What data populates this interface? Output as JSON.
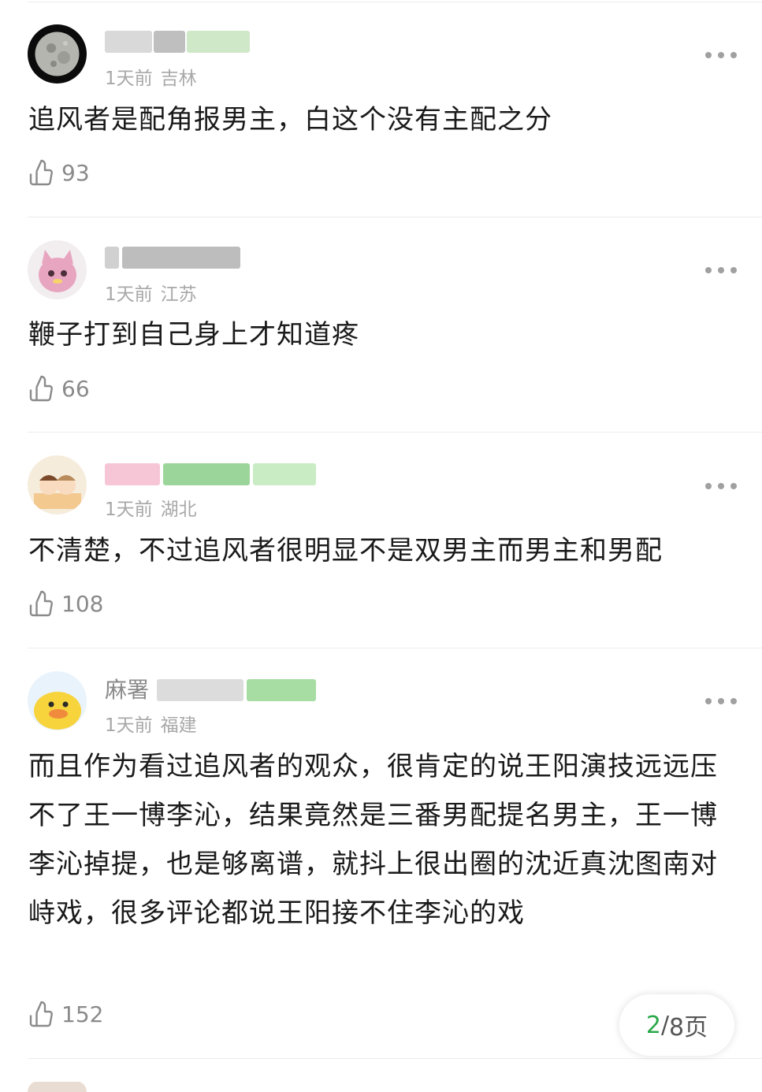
{
  "comments": [
    {
      "username": "",
      "time": "1天前",
      "location": "吉林",
      "text": "追风者是配角报男主，白这个没有主配之分",
      "likes": "93",
      "avatar_icon": "moon-avatar-icon"
    },
    {
      "username": "",
      "time": "1天前",
      "location": "江苏",
      "text": "鞭子打到自己身上才知道疼",
      "likes": "66",
      "avatar_icon": "pink-cat-avatar-icon"
    },
    {
      "username": "",
      "time": "1天前",
      "location": "湖北",
      "text": "不清楚，不过追风者很明显不是双男主而男主和男配",
      "likes": "108",
      "avatar_icon": "cartoon-kids-avatar-icon"
    },
    {
      "username": "麻署",
      "time": "1天前",
      "location": "福建",
      "text": "而且作为看过追风者的观众，很肯定的说王阳演技远远压不了王一博李沁，结果竟然是三番男配提名男主，王一博李沁掉提，也是够离谱，就抖上很出圈的沈近真沈图南对峙戏，很多评论都说王阳接不住李沁的戏",
      "likes": "152",
      "avatar_icon": "yellow-duck-avatar-icon"
    },
    {
      "username": "",
      "avatar_icon": "partial-avatar-icon"
    }
  ],
  "pagination": {
    "current": "2",
    "separator": "/",
    "total_label": "8页"
  },
  "colors": {
    "accent": "#2aa847",
    "secondary_text": "#8a8a8a"
  }
}
